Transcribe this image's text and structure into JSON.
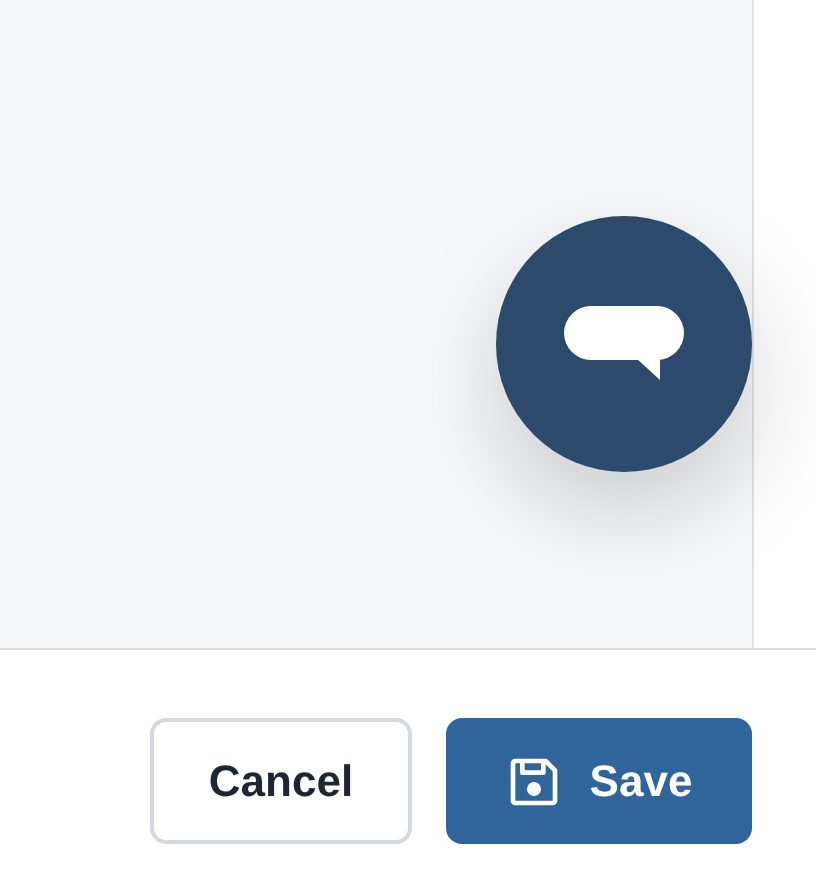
{
  "buttons": [
    {
      "label": "Cancel",
      "kind": "secondary"
    },
    {
      "label": "Save",
      "kind": "primary"
    }
  ]
}
